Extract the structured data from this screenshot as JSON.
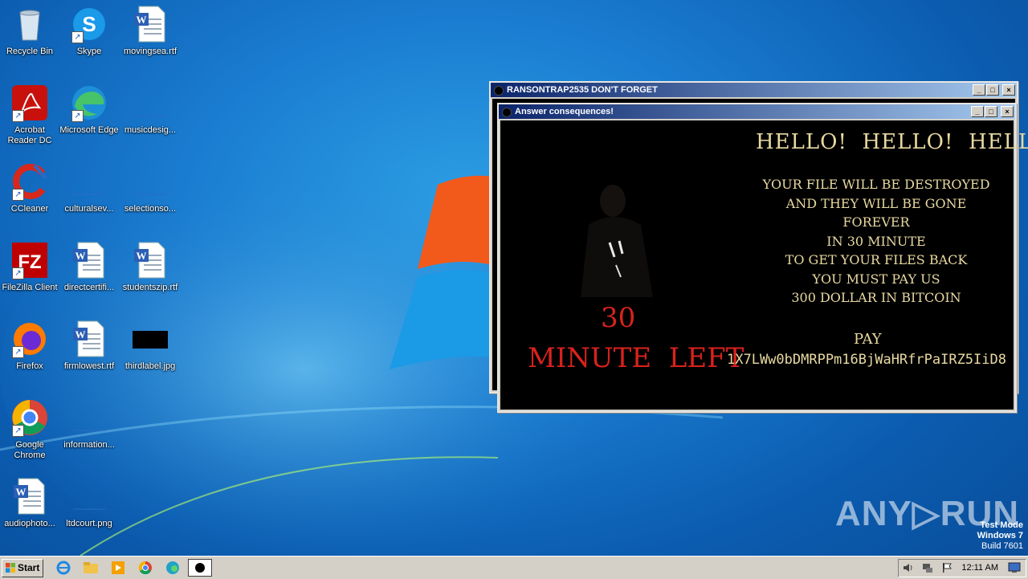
{
  "desktop": {
    "icons": [
      {
        "label": "Recycle Bin",
        "icon": "recycle-bin-icon"
      },
      {
        "label": "Skype",
        "icon": "skype-icon"
      },
      {
        "label": "movingsea.rtf",
        "icon": "word-document-icon"
      },
      {
        "label": "Acrobat Reader DC",
        "icon": "acrobat-icon"
      },
      {
        "label": "Microsoft Edge",
        "icon": "edge-icon"
      },
      {
        "label": "musicdesig...",
        "icon": "blank-file-icon"
      },
      {
        "label": "CCleaner",
        "icon": "ccleaner-icon"
      },
      {
        "label": "culturalsev...",
        "icon": "blank-file-icon"
      },
      {
        "label": "selectionso...",
        "icon": "blank-file-icon"
      },
      {
        "label": "FileZilla Client",
        "icon": "filezilla-icon"
      },
      {
        "label": "directcertifi...",
        "icon": "word-document-icon"
      },
      {
        "label": "studentszip.rtf",
        "icon": "word-document-icon"
      },
      {
        "label": "Firefox",
        "icon": "firefox-icon"
      },
      {
        "label": "firmlowest.rtf",
        "icon": "word-document-icon"
      },
      {
        "label": "thirdlabel.jpg",
        "icon": "black-image-icon"
      },
      {
        "label": "Google Chrome",
        "icon": "chrome-icon"
      },
      {
        "label": "information...",
        "icon": "blank-file-icon"
      },
      {
        "label": "audiophoto...",
        "icon": "word-document-icon"
      },
      {
        "label": "ltdcourt.png",
        "icon": "blank-file-icon"
      }
    ]
  },
  "window_back": {
    "title": "RANSONTRAP2535 DON'T FORGET"
  },
  "window_front": {
    "title": "Answer  consequences!",
    "heading": "HELLO!  HELLO!  HELLO!",
    "message_lines": [
      "YOUR FILE WILL BE DESTROYED",
      "AND THEY WILL BE GONE FOREVER",
      "IN 30 MINUTE",
      "TO GET YOUR FILES BACK",
      "YOU MUST PAY US",
      "300 DOLLAR IN BITCOIN"
    ],
    "countdown_number": "30",
    "countdown_label": "MINUTE  LEFT",
    "pay_label": "PAY",
    "bitcoin_address": "1X7LWw0bDMRPPm16BjWaHRfrPaIRZ5IiD8"
  },
  "window_buttons": {
    "minimize": "_",
    "maximize": "□",
    "close": "×"
  },
  "watermark": {
    "text": "ANY▷RUN"
  },
  "os_notice": {
    "line1": "Test Mode",
    "line2": "Windows 7",
    "line3": "Build 7601"
  },
  "taskbar": {
    "start_label": "Start",
    "pinned": [
      "ie-icon",
      "explorer-icon",
      "media-player-icon",
      "chrome-icon",
      "edge-icon",
      "ransom-app-icon"
    ],
    "clock": "12:11 AM"
  }
}
